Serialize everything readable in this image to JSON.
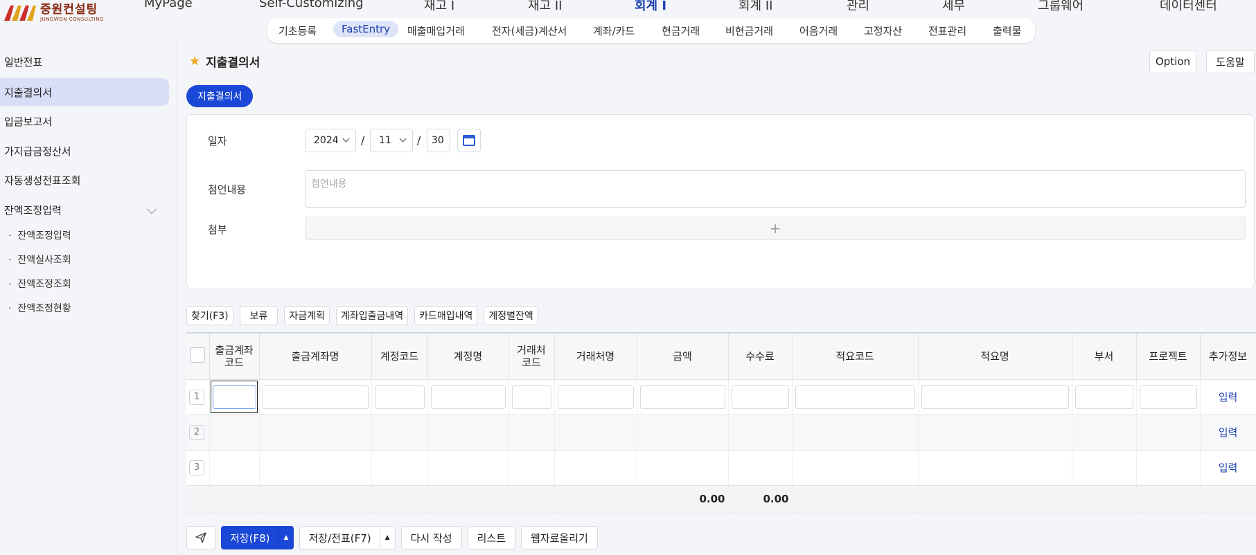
{
  "logo": {
    "ko": "중원컨설팅",
    "en": "JUNGWON CONSULTING"
  },
  "main_menu": [
    "MyPage",
    "Self-Customizing",
    "재고 I",
    "재고 II",
    "회계 I",
    "회계 II",
    "관리",
    "세무",
    "그룹웨어",
    "데이터센터"
  ],
  "sub_menu": [
    "기초등록",
    "FastEntry",
    "매출매입거래",
    "전자(세금)계산서",
    "계좌/카드",
    "현금거래",
    "비현금거래",
    "어음거래",
    "고정자산",
    "전표관리",
    "출력물"
  ],
  "sidebar": {
    "items": [
      "일반전표",
      "지출결의서",
      "입금보고서",
      "가지급금정산서",
      "자동생성전표조회",
      "잔액조정입력"
    ],
    "sub_items": [
      "잔액조정입력",
      "잔액실사조회",
      "잔액조정조회",
      "잔액조정현황"
    ]
  },
  "page": {
    "title": "지출결의서",
    "option_label": "Option",
    "help_label": "도움말",
    "tab_label": "지출결의서"
  },
  "form": {
    "date_label": "일자",
    "year": "2024",
    "month": "11",
    "day": "30",
    "sep": "/",
    "memo_label": "첨언내용",
    "memo_placeholder": "첨언내용",
    "attach_label": "첨부",
    "attach_plus": "+"
  },
  "toolbar": [
    "찾기(F3)",
    "보류",
    "자금계획",
    "계좌입출금내역",
    "카드매입내역",
    "계정별잔액"
  ],
  "grid": {
    "headers": [
      "출금계좌\n코드",
      "출금계좌명",
      "계정코드",
      "계정명",
      "거래처\n코드",
      "거래처명",
      "금액",
      "수수료",
      "적요코드",
      "적요명",
      "부서",
      "프로젝트",
      "추가정보"
    ],
    "rows": [
      "1",
      "2",
      "3"
    ],
    "extra_link": "입력",
    "total_amount": "0.00",
    "total_fee": "0.00"
  },
  "actions": {
    "save": "저장(F8)",
    "save_slip": "저장/전표(F7)",
    "rewrite": "다시 작성",
    "list": "리스트",
    "upload": "웹자료올리기"
  },
  "colors": {
    "primary": "#1a47d6",
    "accent": "#f0a823",
    "brand": "#8a2a12"
  }
}
